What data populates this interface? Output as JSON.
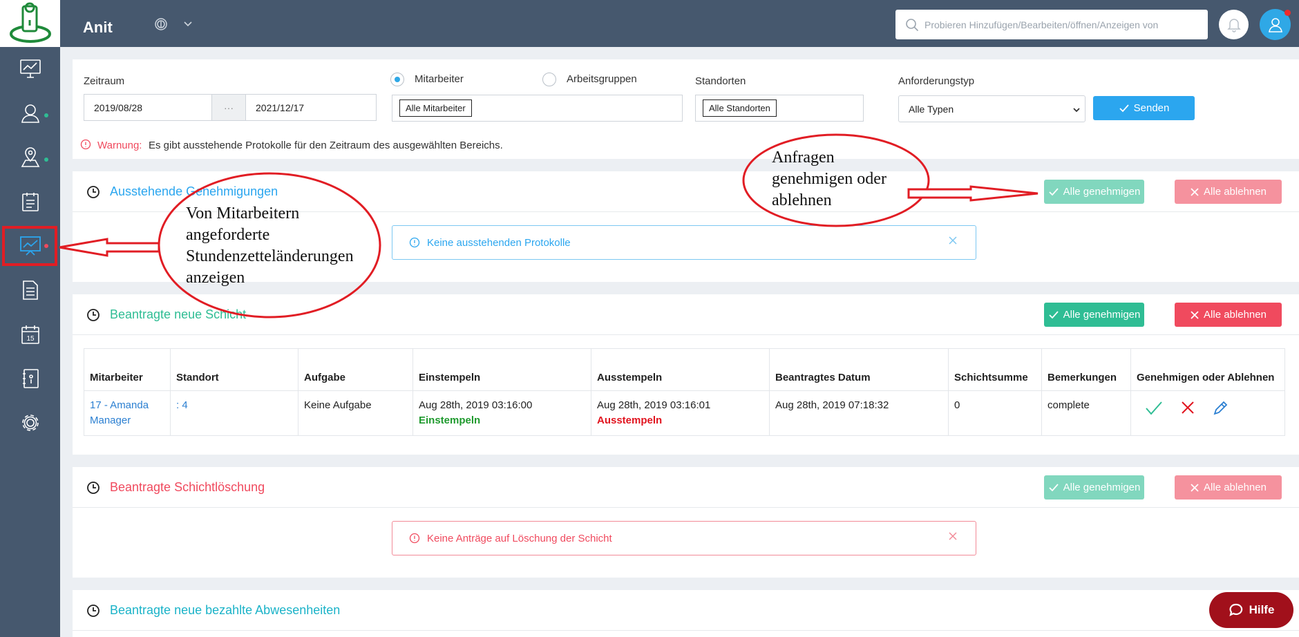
{
  "app": {
    "title": "Anit"
  },
  "search": {
    "placeholder": "Probieren Hinzufügen/Bearbeiten/öffnen/Anzeigen von"
  },
  "colors": {
    "sidebar": "#46586e",
    "accent_blue": "#2ba6ef",
    "approve_green": "#2fbd94",
    "reject_red": "#f04a5e",
    "annotation_red": "#e11d24"
  },
  "sidebar": {
    "items": [
      {
        "icon": "monitor-chart-icon",
        "dot": null
      },
      {
        "icon": "user-icon",
        "dot": "#2fbd94"
      },
      {
        "icon": "map-pin-icon",
        "dot": "#2fbd94"
      },
      {
        "icon": "clipboard-icon",
        "dot": null
      },
      {
        "icon": "presentation-chart-icon",
        "dot": "#f04a5e",
        "active": true
      },
      {
        "icon": "document-icon",
        "dot": null
      },
      {
        "icon": "calendar-icon",
        "dot": null
      },
      {
        "icon": "contacts-book-icon",
        "dot": null
      },
      {
        "icon": "gear-icon",
        "dot": null
      }
    ],
    "calendar_day": "15"
  },
  "filters": {
    "zeitraum_label": "Zeitraum",
    "date_from": "2019/08/28",
    "date_sep": "···",
    "date_to": "2021/12/17",
    "radio_employee": "Mitarbeiter",
    "radio_groups": "Arbeitsgruppen",
    "employee_tag": "Alle Mitarbeiter",
    "locations_label": "Standorten",
    "locations_tag": "Alle Standorten",
    "request_type_label": "Anforderungstyp",
    "request_type_value": "Alle Typen",
    "send_label": "Senden",
    "warning_prefix": "Warnung:",
    "warning_text": "Es gibt ausstehende Protokolle für den Zeitraum des ausgewählten Bereichs."
  },
  "buttons": {
    "approve_all": "Alle genehmigen",
    "reject_all": "Alle ablehnen"
  },
  "sections": {
    "pending": {
      "title": "Ausstehende Genehmigungen",
      "notice": "Keine ausstehenden Protokolle"
    },
    "new_shift": {
      "title": "Beantragte neue Schicht"
    },
    "shift_delete": {
      "title": "Beantragte Schichtlöschung",
      "notice": "Keine Anträge auf Löschung der Schicht"
    },
    "paid_absence": {
      "title": "Beantragte neue bezahlte Abwesenheiten"
    }
  },
  "table": {
    "headers": [
      "Mitarbeiter",
      "Standort",
      "Aufgabe",
      "Einstempeln",
      "Ausstempeln",
      "Beantragtes Datum",
      "Schichtsumme",
      "Bemerkungen",
      "Genehmigen oder Ablehnen"
    ],
    "rows": [
      {
        "employee": "17 - Amanda Manager",
        "location": ": 4",
        "task": "Keine Aufgabe",
        "clock_in": "Aug 28th, 2019 03:16:00",
        "clock_in_status": "Einstempeln",
        "clock_out": "Aug 28th, 2019 03:16:01",
        "clock_out_status": "Ausstempeln",
        "requested_date": "Aug 28th, 2019 07:18:32",
        "shift_total": "0",
        "remarks": "complete"
      }
    ]
  },
  "annotations": {
    "left_lines": [
      "Von Mitarbeitern",
      "angeforderte",
      "Stundenzetteländerungen",
      "anzeigen"
    ],
    "right_lines": [
      "Anfragen",
      "genehmigen oder",
      "ablehnen"
    ]
  },
  "help": {
    "label": "Hilfe"
  }
}
